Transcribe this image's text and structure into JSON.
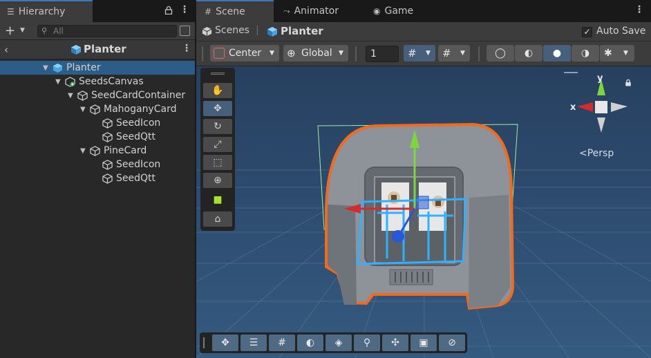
{
  "hierarchy": {
    "tab_label": "Hierarchy",
    "search_placeholder": "All",
    "scene_name": "Planter",
    "tree": [
      {
        "label": "Planter",
        "depth": 0,
        "expanded": true,
        "selected": true,
        "icon": "prefab-icon"
      },
      {
        "label": "SeedsCanvas",
        "depth": 1,
        "expanded": true,
        "icon": "canvas-icon"
      },
      {
        "label": "SeedCardContainer",
        "depth": 2,
        "expanded": true,
        "icon": "cube-icon"
      },
      {
        "label": "MahoganyCard",
        "depth": 3,
        "expanded": true,
        "icon": "cube-icon"
      },
      {
        "label": "SeedIcon",
        "depth": 4,
        "icon": "cube-icon"
      },
      {
        "label": "SeedQtt",
        "depth": 4,
        "icon": "cube-icon"
      },
      {
        "label": "PineCard",
        "depth": 3,
        "expanded": true,
        "icon": "cube-icon"
      },
      {
        "label": "SeedIcon",
        "depth": 4,
        "icon": "cube-icon"
      },
      {
        "label": "SeedQtt",
        "depth": 4,
        "icon": "cube-icon"
      }
    ]
  },
  "tabs": {
    "scene": "Scene",
    "animator": "Animator",
    "game": "Game"
  },
  "breadcrumb": {
    "scenes": "Scenes",
    "prefab": "Planter",
    "auto_save": "Auto Save",
    "auto_save_checked": true
  },
  "toolbar": {
    "pivot": "Center",
    "space": "Global",
    "snap_value": "1"
  },
  "gizmo": {
    "x_label": "x",
    "y_label": "y",
    "projection": "Persp"
  },
  "colors": {
    "selection": "#2c5d87",
    "accent": "#3a79bb",
    "outline": "#f26a1b",
    "axis_x": "#d22c2c",
    "axis_y": "#7ed63f",
    "axis_z": "#2957d6"
  }
}
